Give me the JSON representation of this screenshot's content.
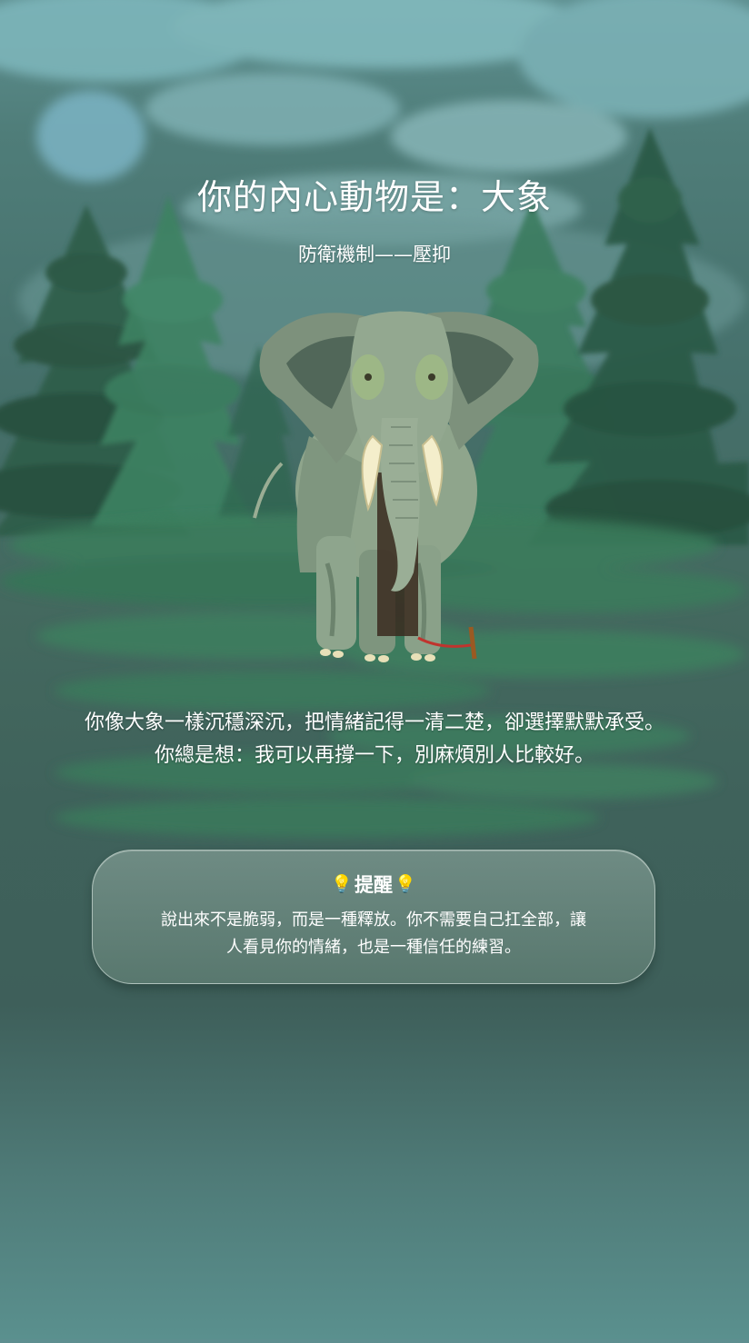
{
  "result": {
    "title": "你的內心動物是：大象",
    "subtitle": "防衛機制——壓抑",
    "animal_image": "elephant-illustration",
    "description": "你像大象一樣沉穩深沉，把情緒記得一清二楚，卻選擇默默承受。你總是想：我可以再撐一下，別麻煩別人比較好。"
  },
  "tip": {
    "icon": "lightbulb-icon",
    "title": "提醒",
    "bulb_glyph": "💡",
    "body": "說出來不是脆弱，而是一種釋放。你不需要自己扛全部，讓人看見你的情緒，也是一種信任的練習。"
  },
  "colors": {
    "sky": "#6aa6ab",
    "forest": "#2f6e58",
    "card": "#7e9c8e",
    "text": "#ffffff"
  }
}
